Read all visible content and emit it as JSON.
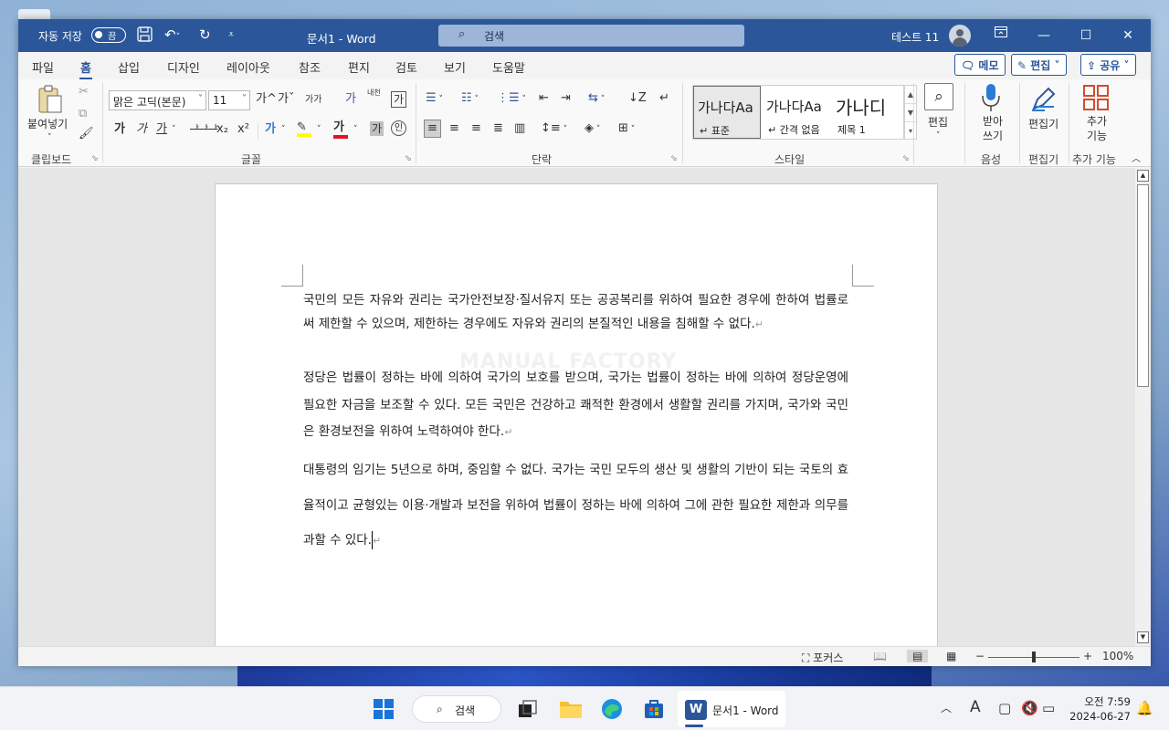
{
  "titlebar": {
    "autosave_label": "자동 저장",
    "autosave_state": "끔",
    "doc_title": "문서1  -  Word",
    "search_placeholder": "검색",
    "user_name": "테스트 11"
  },
  "tabs": [
    "파일",
    "홈",
    "삽입",
    "디자인",
    "레이아웃",
    "참조",
    "편지",
    "검토",
    "보기",
    "도움말"
  ],
  "active_tab": "홈",
  "top_buttons": {
    "memo": "메모",
    "edit": "편집",
    "share": "공유"
  },
  "ribbon": {
    "clipboard": {
      "paste_label": "붙여넣기",
      "group_label": "클립보드"
    },
    "font": {
      "font_name": "맑은 고딕(본문)",
      "font_size": "11",
      "group_label": "글꼴",
      "row1_icons": [
        "가^",
        "가ˇ",
        "가가",
        "가",
        "내천",
        "가"
      ],
      "row2_icons": [
        "가",
        "가",
        "가",
        "가",
        "x₂",
        "x²",
        "가",
        "가",
        "가"
      ]
    },
    "paragraph": {
      "group_label": "단락"
    },
    "styles": {
      "group_label": "스타일",
      "items": [
        {
          "preview": "가나다Aa",
          "name": "↵ 표준"
        },
        {
          "preview": "가나다Aa",
          "name": "↵ 간격 없음"
        },
        {
          "preview": "가나디",
          "name": "제목 1"
        }
      ]
    },
    "editing": {
      "label": "편집",
      "group_label": ""
    },
    "voice": {
      "label": "받아쓰기",
      "group_label": "음성"
    },
    "editor": {
      "label": "편집기",
      "group_label": "편집기"
    },
    "addins": {
      "label": "추가 기능",
      "group_label": "추가 기능"
    }
  },
  "document": {
    "watermark": "MANUAL FACTORY",
    "paragraphs": [
      "국민의 모든 자유와 권리는 국가안전보장·질서유지 또는 공공복리를 위하여 필요한 경우에 한하여 법률로써 제한할 수 있으며, 제한하는 경우에도 자유와 권리의 본질적인 내용을 침해할 수 없다.",
      "정당은 법률이 정하는 바에 의하여 국가의 보호를 받으며, 국가는 법률이 정하는 바에 의하여 정당운영에 필요한 자금을 보조할 수 있다. 모든 국민은 건강하고 쾌적한 환경에서 생활할 권리를 가지며, 국가와 국민은 환경보전을 위하여 노력하여야 한다.",
      "대통령의 임기는 5년으로 하며, 중임할 수 없다. 국가는 국민 모두의 생산 및 생활의 기반이 되는 국토의 효율적이고 균형있는 이용·개발과 보전을 위하여 법률이 정하는 바에 의하여 그에 관한 필요한 제한과 의무를 과할 수 있다."
    ],
    "para_mark": "↵"
  },
  "statusbar": {
    "focus": "포커스",
    "zoom": "100%",
    "zoom_level": 1.0
  },
  "taskbar": {
    "search": "검색",
    "word_app": "문서1 - Word",
    "time": "오전 7:59",
    "date": "2024-06-27"
  },
  "colors": {
    "accent": "#2b579a"
  }
}
